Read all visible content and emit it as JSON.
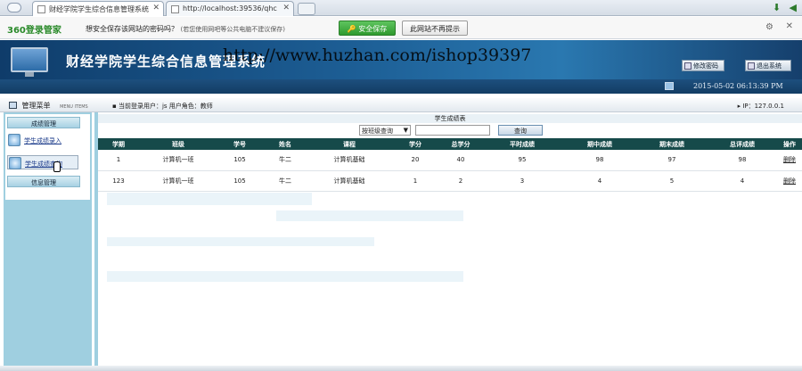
{
  "browser": {
    "tabs": [
      {
        "label": "财经学院学生综合信息管理系统"
      },
      {
        "label": "http://localhost:39536/qhc"
      }
    ]
  },
  "password_bar": {
    "logo": "360登录管家",
    "prompt": "想安全保存该网站的密码吗？",
    "note": "(若您使用网吧等公共电脑不建议保存)",
    "save_label": "安全保存",
    "never_label": "此网站不再提示"
  },
  "app": {
    "title": "财经学院学生综合信息管理系统",
    "watermark": "http://www.huzhan.com/ishop39397",
    "change_password_label": "修改密码",
    "logout_label": "退出系统",
    "datetime": "2015-05-02 06:13:39 PM"
  },
  "info": {
    "menu_header": "管理菜单",
    "menu_sub": "MENU ITEMS",
    "current_user": "当前登录用户：js 用户角色：教师",
    "ip": "IP：127.0.0.1"
  },
  "sidebar": {
    "groups": [
      {
        "label": "成绩管理"
      },
      {
        "label": "信息管理"
      }
    ],
    "links": [
      {
        "label": "学生成绩录入"
      },
      {
        "label": "学生成绩查询"
      }
    ]
  },
  "main": {
    "caption": "学生成绩表",
    "search_select": "按班级查询",
    "search_button": "查询",
    "columns": [
      "学期",
      "班级",
      "学号",
      "姓名",
      "课程",
      "学分",
      "总学分",
      "平时成绩",
      "期中成绩",
      "期末成绩",
      "总评成绩",
      "操作"
    ],
    "rows": [
      [
        "1",
        "计算机一班",
        "105",
        "牛二",
        "计算机基础",
        "20",
        "40",
        "95",
        "98",
        "97",
        "98",
        "删除"
      ],
      [
        "123",
        "计算机一班",
        "105",
        "牛二",
        "计算机基础",
        "1",
        "2",
        "3",
        "4",
        "5",
        "4",
        "删除"
      ]
    ]
  }
}
